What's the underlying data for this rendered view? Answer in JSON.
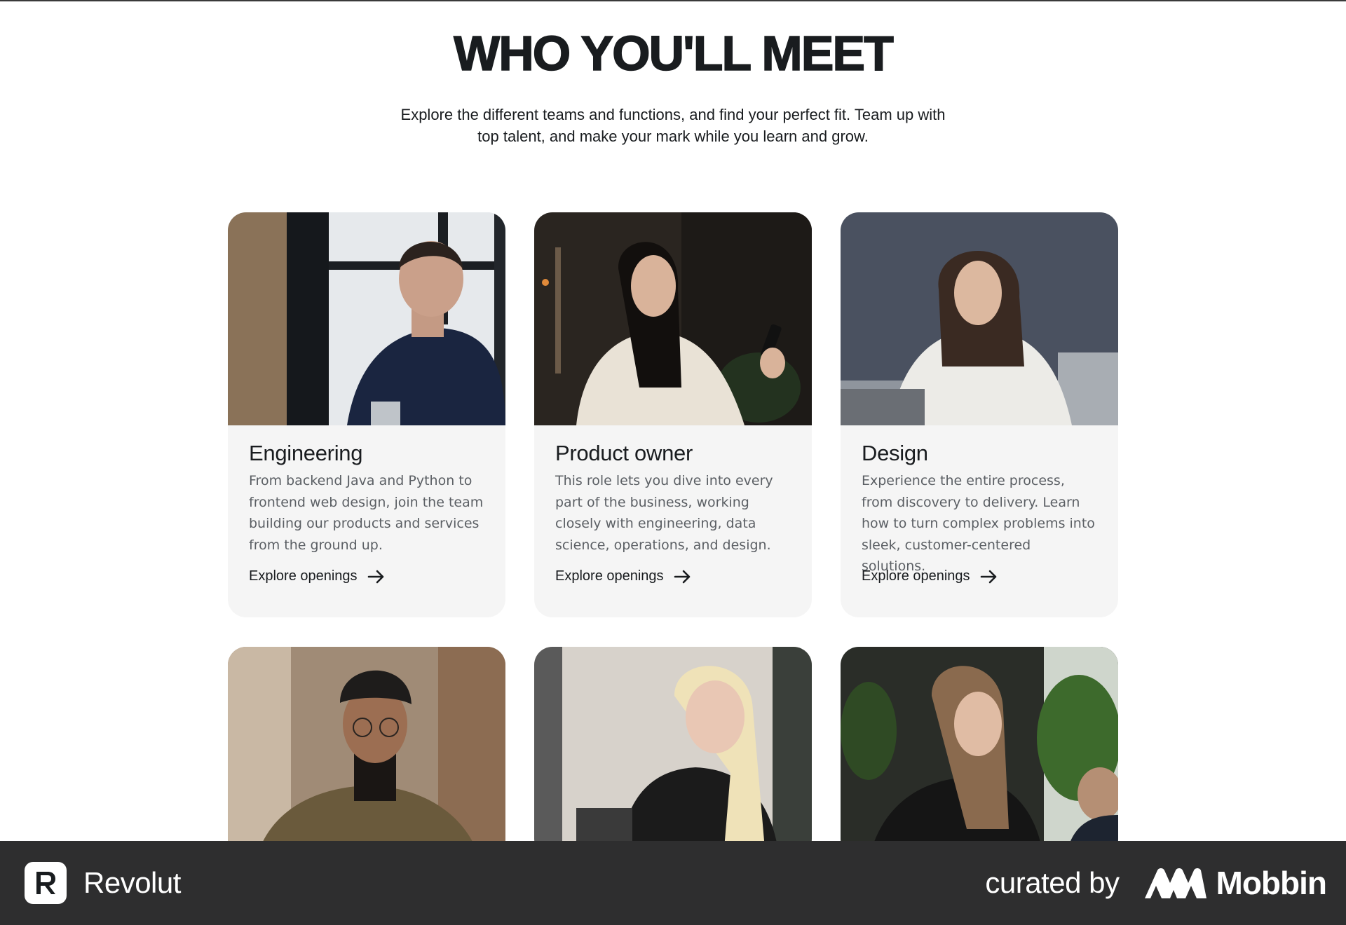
{
  "hero": {
    "title": "WHO YOU'LL MEET",
    "subtitle": "Explore the different teams and functions, and find your perfect fit. Team up with top talent, and make your mark while you learn and grow."
  },
  "cards": [
    {
      "title": "Engineering",
      "description": "From backend Java and Python to frontend web design, join the team building our products and services from the ground up.",
      "link": "Explore openings",
      "photo_icon": "person-photo"
    },
    {
      "title": "Product owner",
      "description": "This role lets you dive into every part of the business, working closely with engineering, data science, operations, and design.",
      "link": "Explore openings",
      "photo_icon": "person-photo"
    },
    {
      "title": "Design",
      "description": "Experience the entire process, from discovery to delivery. Learn how to turn complex problems into sleek, customer-centered solutions.",
      "link": "Explore openings",
      "photo_icon": "person-photo"
    }
  ],
  "footer": {
    "brand": "Revolut",
    "curated_by": "curated by",
    "curator": "Mobbin"
  },
  "colors": {
    "text": "#191c1f",
    "muted": "#5b5f64",
    "card_bg": "#f5f5f5",
    "footer_bg": "#2e2e2f"
  }
}
